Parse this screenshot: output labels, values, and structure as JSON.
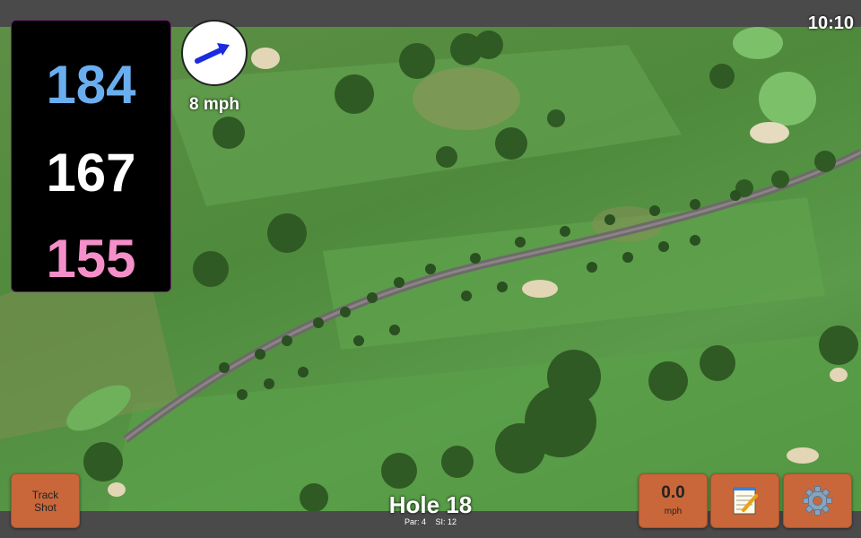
{
  "status_bar": {
    "time": "10:10"
  },
  "distances": {
    "back": "184",
    "middle": "167",
    "front": "155"
  },
  "wind": {
    "speed": "8 mph",
    "direction_icon": "arrow-icon"
  },
  "buttons": {
    "track_shot_line1": "Track",
    "track_shot_line2": "Shot",
    "speed_value": "0.0",
    "speed_unit": "mph",
    "notes_icon": "notepad-icon",
    "settings_icon": "gear-icon"
  },
  "hole": {
    "title": "Hole 18",
    "par": "Par: 4",
    "si": "SI: 12"
  },
  "colors": {
    "back_distance": "#6aaef0",
    "middle_distance": "#ffffff",
    "front_distance": "#f58fc9",
    "button_bg": "#c9673a"
  }
}
